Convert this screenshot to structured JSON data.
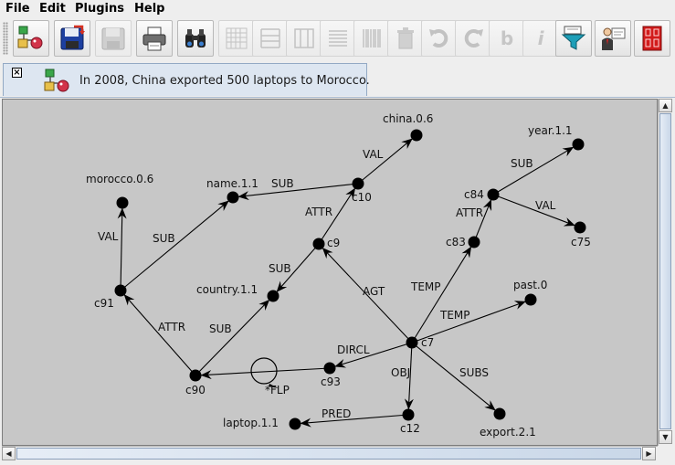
{
  "menu": {
    "items": [
      "File",
      "Edit",
      "Plugins",
      "Help"
    ]
  },
  "toolbar": {
    "disabled_labels": {
      "bold": "b",
      "info": "i"
    }
  },
  "tab": {
    "close_symbol": "×",
    "title": "In 2008, China exported 500 laptops to Morocco."
  },
  "scroll": {
    "up": "▲",
    "down": "▼",
    "left": "◀",
    "right": "▶"
  },
  "graph": {
    "nodes": [
      {
        "id": "china",
        "label": "china.0.6"
      },
      {
        "id": "c10",
        "label": "c10"
      },
      {
        "id": "name",
        "label": "name.1.1"
      },
      {
        "id": "morocco",
        "label": "morocco.0.6"
      },
      {
        "id": "c9",
        "label": "c9"
      },
      {
        "id": "country",
        "label": "country.1.1"
      },
      {
        "id": "c91",
        "label": "c91"
      },
      {
        "id": "c90",
        "label": "c90"
      },
      {
        "id": "c93",
        "label": "c93"
      },
      {
        "id": "c7",
        "label": "c7"
      },
      {
        "id": "c12",
        "label": "c12"
      },
      {
        "id": "laptop",
        "label": "laptop.1.1"
      },
      {
        "id": "export",
        "label": "export.2.1"
      },
      {
        "id": "past",
        "label": "past.0"
      },
      {
        "id": "c83",
        "label": "c83"
      },
      {
        "id": "c84",
        "label": "c84"
      },
      {
        "id": "year",
        "label": "year.1.1"
      },
      {
        "id": "c75",
        "label": "c75"
      }
    ],
    "edges": [
      {
        "from": "c10",
        "to": "china",
        "label": "VAL"
      },
      {
        "from": "c10",
        "to": "name",
        "label": "SUB"
      },
      {
        "from": "c9",
        "to": "c10",
        "label": "ATTR"
      },
      {
        "from": "c9",
        "to": "country",
        "label": "SUB"
      },
      {
        "from": "c91",
        "to": "morocco",
        "label": "VAL"
      },
      {
        "from": "c91",
        "to": "name",
        "label": "SUB"
      },
      {
        "from": "c90",
        "to": "c91",
        "label": "ATTR"
      },
      {
        "from": "c90",
        "to": "country",
        "label": "SUB"
      },
      {
        "from": "c93",
        "to": "c90",
        "label": ""
      },
      {
        "from": "c7",
        "to": "c9",
        "label": "AGT"
      },
      {
        "from": "c7",
        "to": "c93",
        "label": "DIRCL"
      },
      {
        "from": "c7",
        "to": "c12",
        "label": "OBJ"
      },
      {
        "from": "c12",
        "to": "laptop",
        "label": "PRED"
      },
      {
        "from": "c7",
        "to": "export",
        "label": "SUBS"
      },
      {
        "from": "c7",
        "to": "past",
        "label": "TEMP"
      },
      {
        "from": "c7",
        "to": "c83",
        "label": "TEMP"
      },
      {
        "from": "c83",
        "to": "c84",
        "label": "ATTR"
      },
      {
        "from": "c84",
        "to": "year",
        "label": "SUB"
      },
      {
        "from": "c84",
        "to": "c75",
        "label": "VAL"
      }
    ],
    "flp_label": "*FLP"
  }
}
